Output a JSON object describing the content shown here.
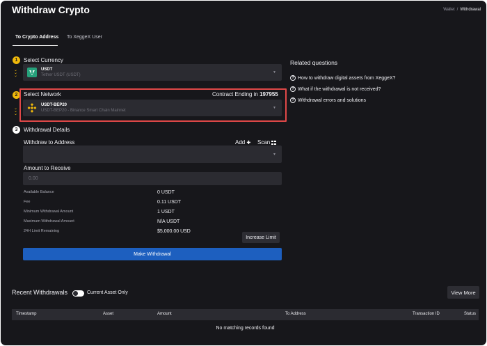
{
  "header": {
    "title": "Withdraw Crypto"
  },
  "breadcrumb": {
    "parent": "Wallet",
    "separator": "/",
    "current": "Withdrawal"
  },
  "tabs": [
    {
      "label": "To Crypto Address",
      "active": true
    },
    {
      "label": "To XeggeX User",
      "active": false
    }
  ],
  "steps": {
    "currency": {
      "number": "1",
      "label": "Select Currency",
      "selected": {
        "symbol": "USDT",
        "name": "Tether USDT (USDT)",
        "icon": "tether-icon",
        "color": "#26a17b"
      }
    },
    "network": {
      "number": "2",
      "label": "Select Network",
      "contract_label": "Contract Ending in",
      "contract_value": "197955",
      "selected": {
        "symbol": "USDT-BEP20",
        "name": "USDT-BEP20 - Binance Smart Chain Mainnet",
        "icon": "bnb-icon",
        "color": "#f0b90b"
      }
    },
    "details": {
      "number": "3",
      "label": "Withdrawal Details",
      "address_label": "Withdraw to Address",
      "add_label": "Add",
      "scan_label": "Scan",
      "address_value": "",
      "amount_label": "Amount to Receive",
      "amount_placeholder": "0.00"
    }
  },
  "summary": [
    {
      "label": "Available Balance",
      "value": "0 USDT"
    },
    {
      "label": "Fee",
      "value": "0.11 USDT"
    },
    {
      "label": "Minimum Withdrawal Amount",
      "value": "1 USDT"
    },
    {
      "label": "Maximum Withdrawal Amount",
      "value": "N/A USDT"
    },
    {
      "label": "24H Limit Remaining",
      "value": "$5,000.00 USD"
    }
  ],
  "increase_limit_label": "Increase Limit",
  "submit_label": "Make Withdrawal",
  "related": {
    "title": "Related questions",
    "items": [
      "How to withdraw digital assets from XeggeX?",
      "What if the withdrawal is not received?",
      "Withdrawal errors and solutions"
    ]
  },
  "recent": {
    "title": "Recent Withdrawals",
    "toggle_label": "Current Asset Only",
    "toggle_on": false,
    "view_more_label": "View More",
    "columns": [
      "Timestamp",
      "Asset",
      "Amount",
      "To Address",
      "Transaction ID",
      "Status"
    ],
    "empty_text": "No matching records found"
  },
  "colors": {
    "background": "#17171b",
    "accent_gold": "#f0b90b",
    "button_blue": "#1d5fbf",
    "highlight_red": "#e04848"
  }
}
